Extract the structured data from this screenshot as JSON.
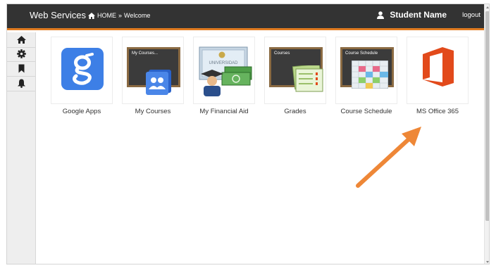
{
  "header": {
    "brand": "Web Services",
    "breadcrumb_home": "HOME",
    "breadcrumb_sep": "»",
    "breadcrumb_current": "Welcome",
    "user_name": "Student Name",
    "logout": "logout"
  },
  "sidebar": {
    "items": [
      {
        "icon": "home-icon"
      },
      {
        "icon": "gear-icon"
      },
      {
        "icon": "bookmark-icon"
      },
      {
        "icon": "bell-icon"
      }
    ]
  },
  "apps": [
    {
      "label": "Google Apps",
      "icon": "google-apps-icon"
    },
    {
      "label": "My Courses",
      "icon": "my-courses-icon",
      "board_text": "My Courses..."
    },
    {
      "label": "My Financial Aid",
      "icon": "financial-aid-icon",
      "diploma_text": "UNIVERSIDAD"
    },
    {
      "label": "Grades",
      "icon": "grades-icon",
      "board_text": "Courses"
    },
    {
      "label": "Course Schedule",
      "icon": "course-schedule-icon",
      "board_text": "Course Schedule"
    },
    {
      "label": "MS Office 365",
      "icon": "ms-office-icon"
    }
  ],
  "colors": {
    "topbar": "#333333",
    "accent_orange": "#e07b20",
    "google_blue": "#3d7fe6",
    "office_red": "#e24a1b",
    "arrow_orange": "#ee8737"
  },
  "annotation": {
    "type": "arrow",
    "points_to": "MS Office 365"
  }
}
